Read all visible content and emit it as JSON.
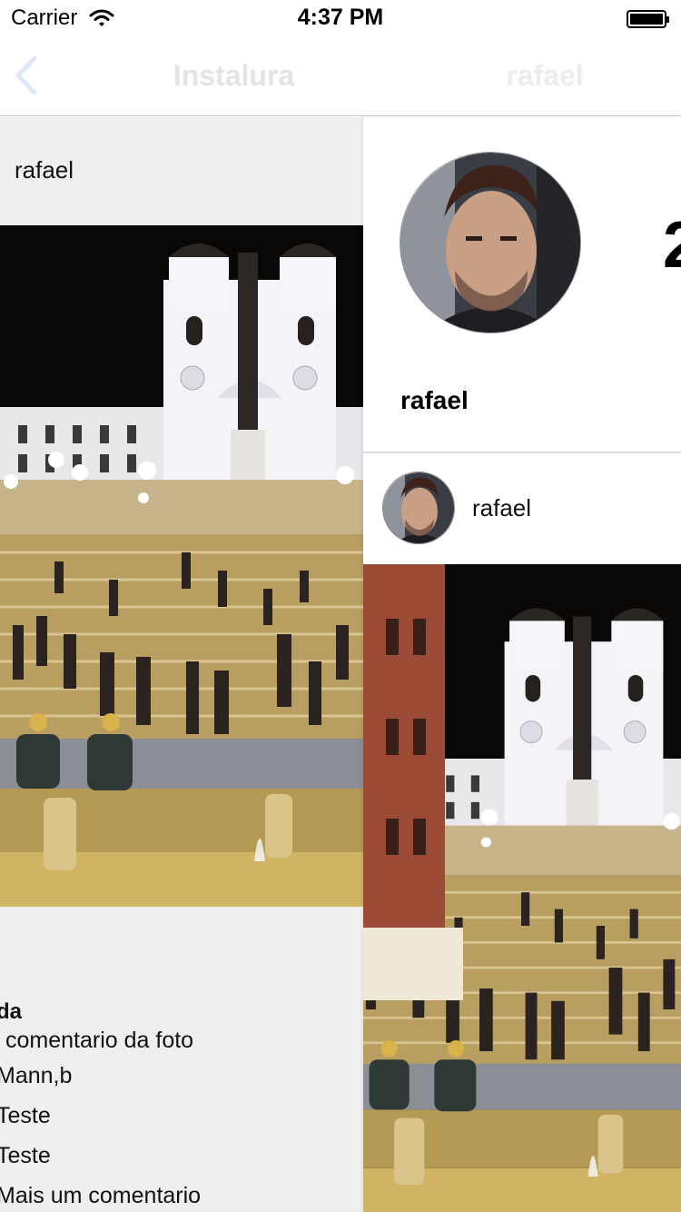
{
  "status_bar": {
    "carrier": "Carrier",
    "time": "4:37 PM"
  },
  "nav": {
    "back_icon": "chevron-left-icon",
    "previous_title": "Instalura",
    "current_title": "rafael"
  },
  "feed_screen": {
    "header_username": "rafael",
    "caption_username": "da",
    "caption_text": "comentario da foto",
    "comments": [
      "Mann,b",
      "Teste",
      "Teste",
      "Mais um comentario"
    ]
  },
  "profile_screen": {
    "stat_count": "2",
    "name": "rafael",
    "post_username": "rafael"
  },
  "colors": {
    "accent": "#007aff",
    "nav_title_faded": "#e4e4e4",
    "feed_background": "#efefef"
  }
}
